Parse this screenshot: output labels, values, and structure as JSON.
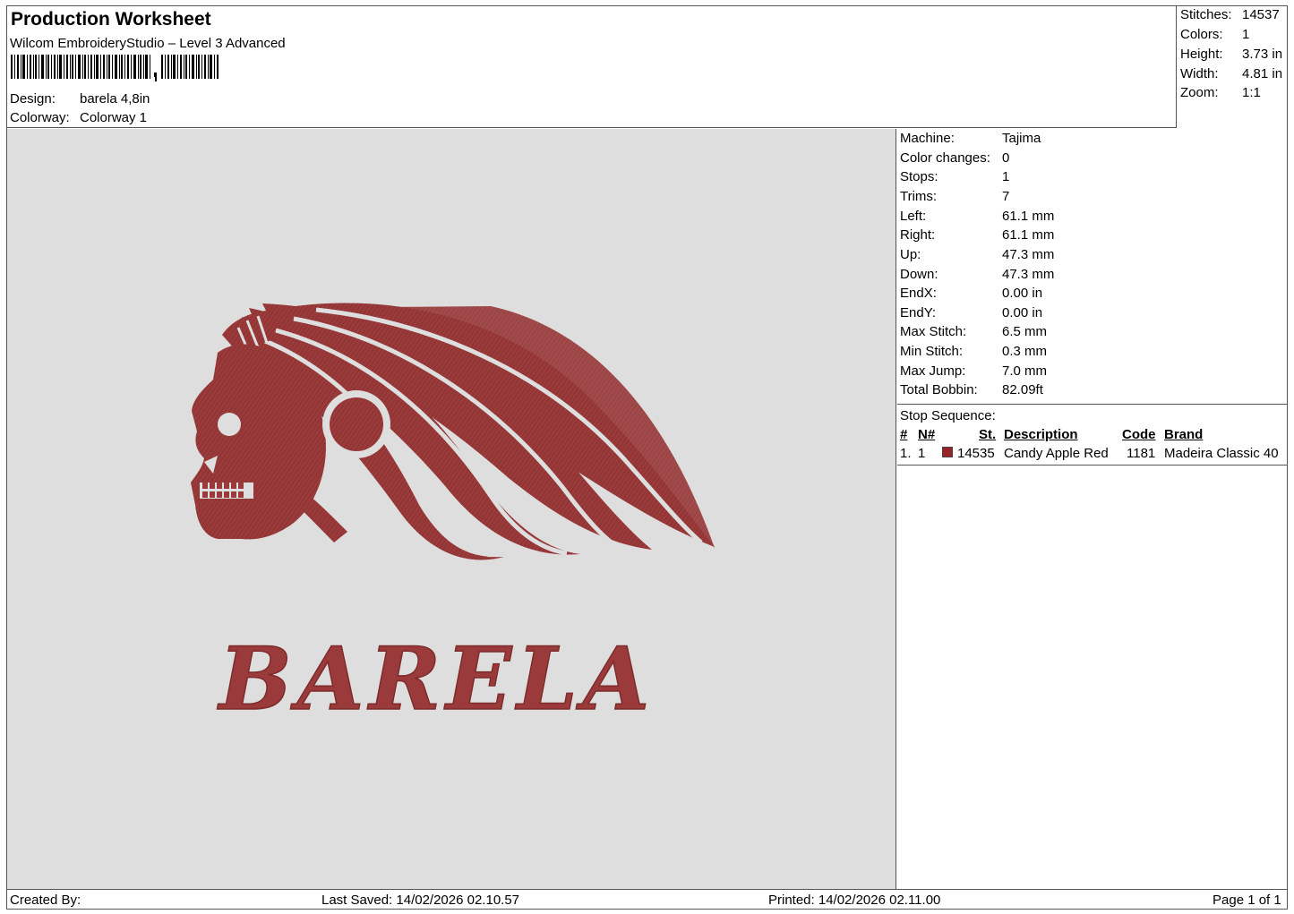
{
  "header": {
    "title": "Production Worksheet",
    "software": "Wilcom EmbroideryStudio – Level 3 Advanced",
    "design_label": "Design:",
    "design_value": "barela 4,8in",
    "colorway_label": "Colorway:",
    "colorway_value": "Colorway 1"
  },
  "stats": {
    "stitches_label": "Stitches:",
    "stitches": "14537",
    "colors_label": "Colors:",
    "colors": "1",
    "height_label": "Height:",
    "height": "3.73 in",
    "width_label": "Width:",
    "width": "4.81 in",
    "zoom_label": "Zoom:",
    "zoom": "1:1"
  },
  "machine_info": {
    "machine_label": "Machine:",
    "machine": "Tajima",
    "color_changes_label": "Color changes:",
    "color_changes": "0",
    "stops_label": "Stops:",
    "stops": "1",
    "trims_label": "Trims:",
    "trims": "7",
    "left_label": "Left:",
    "left": "61.1 mm",
    "right_label": "Right:",
    "right": "61.1 mm",
    "up_label": "Up:",
    "up": "47.3 mm",
    "down_label": "Down:",
    "down": "47.3 mm",
    "endx_label": "EndX:",
    "endx": "0.00 in",
    "endy_label": "EndY:",
    "endy": "0.00 in",
    "max_stitch_label": "Max Stitch:",
    "max_stitch": "6.5 mm",
    "min_stitch_label": "Min Stitch:",
    "min_stitch": "0.3 mm",
    "max_jump_label": "Max Jump:",
    "max_jump": "7.0 mm",
    "total_bobbin_label": "Total Bobbin:",
    "total_bobbin": "82.09ft"
  },
  "stop_sequence": {
    "heading": "Stop Sequence:",
    "columns": {
      "num": "#",
      "n": "N#",
      "st": "St.",
      "description": "Description",
      "code": "Code",
      "brand": "Brand"
    },
    "rows": [
      {
        "num": "1.",
        "n": "1",
        "st": "14535",
        "description": "Candy Apple Red",
        "code": "1181",
        "brand": "Madeira Classic 40",
        "color": "#9b2328"
      }
    ]
  },
  "design_preview": {
    "lettering": "BARELA",
    "thread_color": "#9b3a3a",
    "background_color": "#dedede"
  },
  "footer": {
    "created_by": "Created By:",
    "last_saved": "Last Saved: 14/02/2026 02.10.57",
    "printed": "Printed: 14/02/2026 02.11.00",
    "page": "Page 1 of 1"
  }
}
